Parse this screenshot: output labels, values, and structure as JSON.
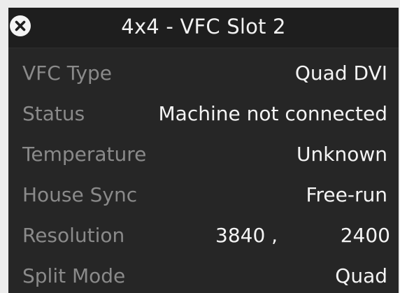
{
  "window": {
    "title": "4x4 - VFC Slot 2",
    "close_icon": "close-x-circle-icon"
  },
  "properties": {
    "vfc_type": {
      "label": "VFC Type",
      "value": "Quad DVI"
    },
    "status": {
      "label": "Status",
      "value": "Machine not connected"
    },
    "temperature": {
      "label": "Temperature",
      "value": "Unknown"
    },
    "house_sync": {
      "label": "House Sync",
      "value": "Free-run"
    },
    "resolution": {
      "label": "Resolution",
      "width": "3840 ,",
      "height": "2400"
    },
    "split_mode": {
      "label": "Split Mode",
      "value": "Quad"
    }
  },
  "colors": {
    "panel_background": "#262626",
    "title_background": "#1e1e1e",
    "label_text": "#8a8a8a",
    "value_text": "#f4f4f4",
    "page_background": "#ececec"
  }
}
